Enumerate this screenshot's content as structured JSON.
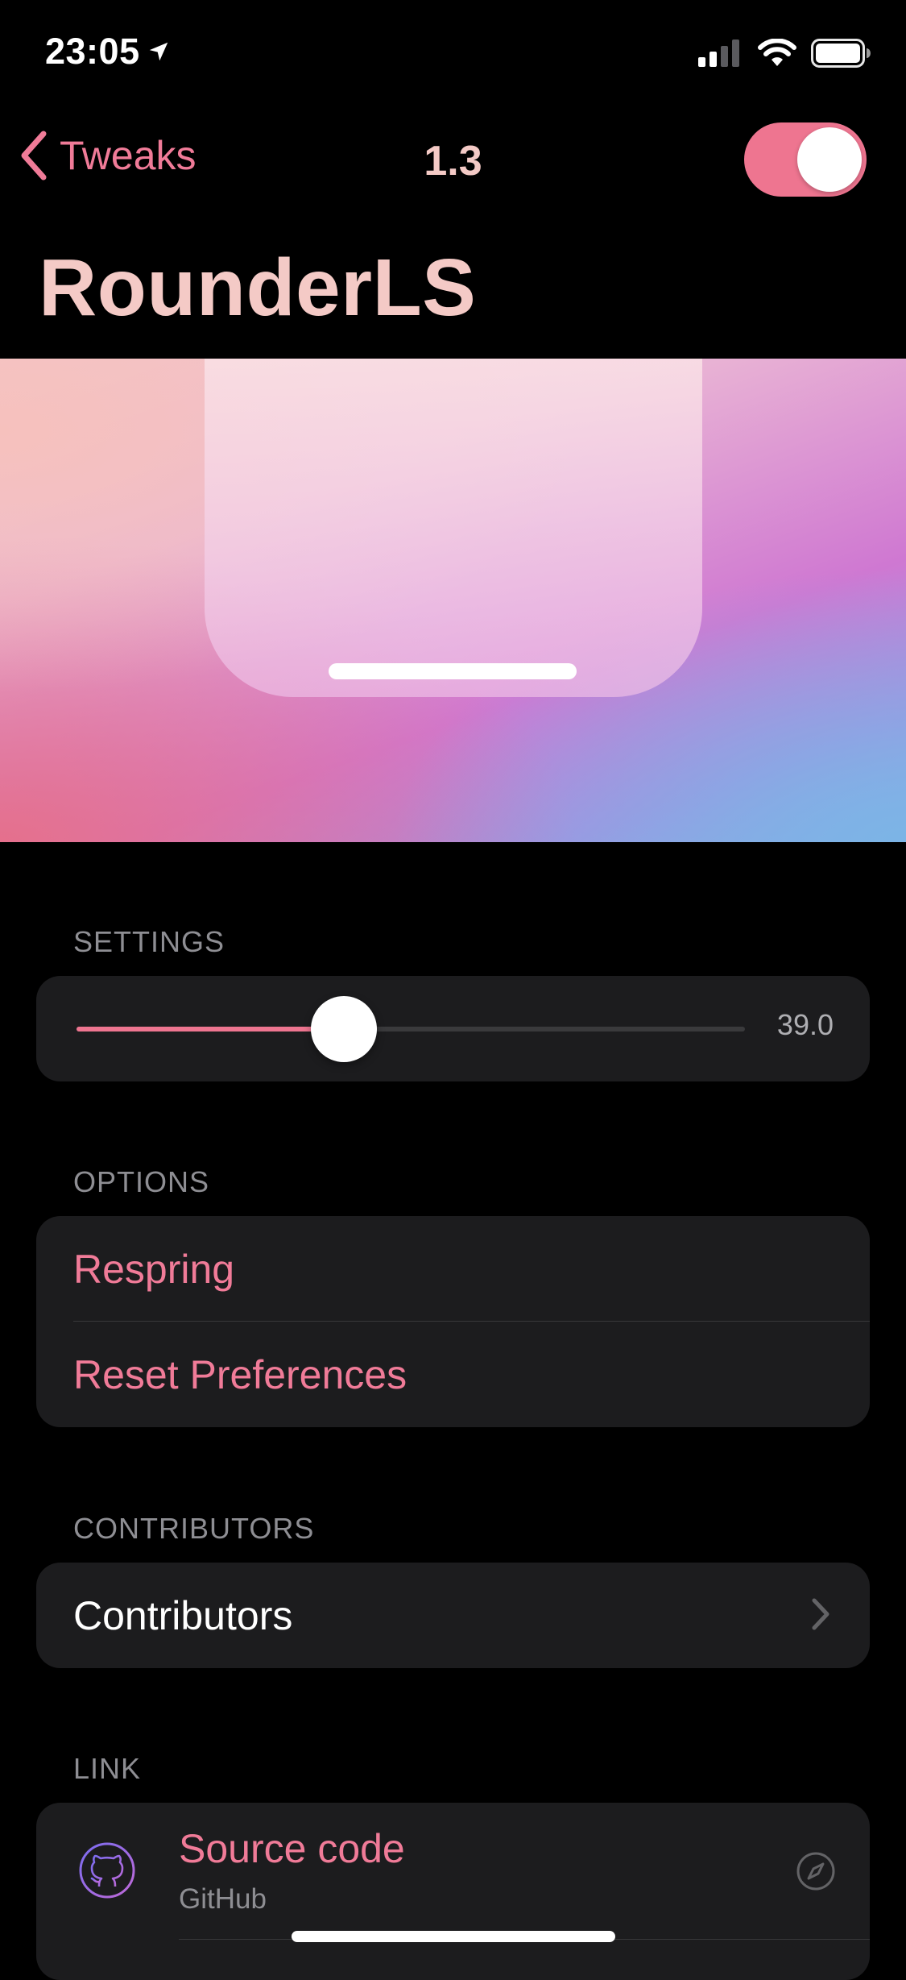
{
  "status_bar": {
    "time": "23:05"
  },
  "nav": {
    "back_label": "Tweaks",
    "title": "1.3",
    "enabled": true,
    "large_title": "RounderLS"
  },
  "settings": {
    "header": "SETTINGS",
    "slider": {
      "value": 39.0,
      "value_label": "39.0",
      "fill_fraction": 0.4
    }
  },
  "options": {
    "header": "OPTIONS",
    "items": [
      {
        "label": "Respring"
      },
      {
        "label": "Reset Preferences"
      }
    ]
  },
  "contributors": {
    "header": "CONTRIBUTORS",
    "item_label": "Contributors"
  },
  "link": {
    "header": "LINK",
    "item": {
      "title": "Source code",
      "subtitle": "GitHub"
    }
  },
  "colors": {
    "accent": "#ee7590",
    "title": "#f4cac6",
    "card": "#1c1c1e"
  }
}
